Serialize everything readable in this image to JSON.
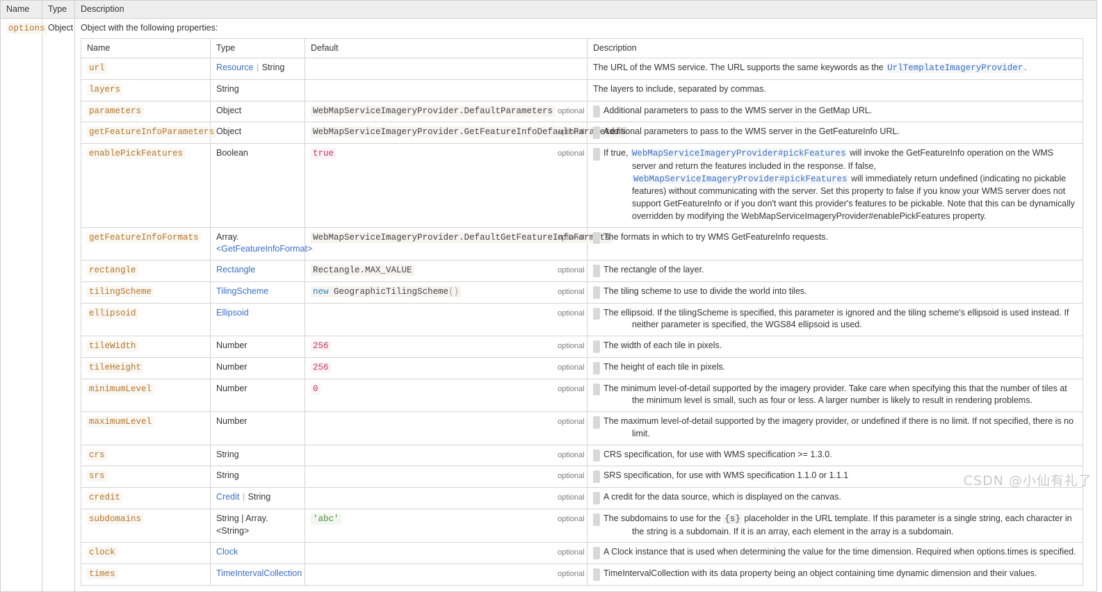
{
  "outer_table": {
    "headers": [
      "Name",
      "Type",
      "Description"
    ],
    "row": {
      "name": "options",
      "type": "Object",
      "intro": "Object with the following properties:"
    }
  },
  "inner_table": {
    "headers": [
      "Name",
      "Type",
      "Default",
      "Description"
    ],
    "badge_optional": "optional",
    "rows": [
      {
        "name": "url",
        "type_link": "Resource",
        "type_sep": "|",
        "type_plain": "String",
        "default": "",
        "optional": false,
        "desc_pre": "The URL of the WMS service. The URL supports the same keywords as the ",
        "desc_link": "UrlTemplateImageryProvider",
        "desc_post": "."
      },
      {
        "name": "layers",
        "type_plain": "String",
        "default": "",
        "optional": false,
        "desc_pre": "The layers to include, separated by commas.",
        "desc_link": "",
        "desc_post": ""
      },
      {
        "name": "parameters",
        "type_plain": "Object",
        "default": "WebMapServiceImageryProvider.DefaultParameters",
        "optional": true,
        "desc_pre": "Additional parameters to pass to the WMS server in the GetMap URL.",
        "desc_link": "",
        "desc_post": ""
      },
      {
        "name": "getFeatureInfoParameters",
        "type_plain": "Object",
        "default": "WebMapServiceImageryProvider.GetFeatureInfoDefaultParameters",
        "optional": true,
        "desc_pre": "Additional parameters to pass to the WMS server in the GetFeatureInfo URL.",
        "desc_link": "",
        "desc_post": ""
      },
      {
        "name": "enablePickFeatures",
        "type_plain": "Boolean",
        "default_literal": "true",
        "optional": true,
        "desc_pre": "If true, ",
        "desc_link": "WebMapServiceImageryProvider#pickFeatures",
        "desc_mid": " will invoke the GetFeatureInfo operation on the WMS server and return the features included in the response. If false, ",
        "desc_link2": "WebMapServiceImageryProvider#pickFeatures",
        "desc_post": " will immediately return undefined (indicating no pickable features) without communicating with the server. Set this property to false if you know your WMS server does not support GetFeatureInfo or if you don't want this provider's features to be pickable. Note that this can be dynamically overridden by modifying the WebMapServiceImageryProvider#enablePickFeatures property."
      },
      {
        "name": "getFeatureInfoFormats",
        "type_plain": "Array.",
        "type_link2": "<GetFeatureInfoFormat>",
        "default": "WebMapServiceImageryProvider.DefaultGetFeatureInfoFormats",
        "optional": true,
        "desc_pre": "The formats in which to try WMS GetFeatureInfo requests.",
        "desc_link": "",
        "desc_post": ""
      },
      {
        "name": "rectangle",
        "type_link": "Rectangle",
        "default": "Rectangle.MAX_VALUE",
        "optional": true,
        "desc_pre": "The rectangle of the layer.",
        "desc_link": "",
        "desc_post": ""
      },
      {
        "name": "tilingScheme",
        "type_link": "TilingScheme",
        "default_new": "new",
        "default_expr": "GeographicTilingScheme",
        "default_parens": "()",
        "optional": true,
        "desc_pre": "The tiling scheme to use to divide the world into tiles.",
        "desc_link": "",
        "desc_post": ""
      },
      {
        "name": "ellipsoid",
        "type_link": "Ellipsoid",
        "default": "",
        "optional": true,
        "desc_pre": "The ellipsoid. If the tilingScheme is specified, this parameter is ignored and the tiling scheme's ellipsoid is used instead. If neither parameter is specified, the WGS84 ellipsoid is used.",
        "desc_link": "",
        "desc_post": ""
      },
      {
        "name": "tileWidth",
        "type_plain": "Number",
        "default_literal": "256",
        "optional": true,
        "desc_pre": "The width of each tile in pixels.",
        "desc_link": "",
        "desc_post": ""
      },
      {
        "name": "tileHeight",
        "type_plain": "Number",
        "default_literal": "256",
        "optional": true,
        "desc_pre": "The height of each tile in pixels.",
        "desc_link": "",
        "desc_post": ""
      },
      {
        "name": "minimumLevel",
        "type_plain": "Number",
        "default_literal": "0",
        "optional": true,
        "desc_pre": "The minimum level-of-detail supported by the imagery provider. Take care when specifying this that the number of tiles at the minimum level is small, such as four or less. A larger number is likely to result in rendering problems.",
        "desc_link": "",
        "desc_post": ""
      },
      {
        "name": "maximumLevel",
        "type_plain": "Number",
        "default": "",
        "optional": true,
        "desc_pre": "The maximum level-of-detail supported by the imagery provider, or undefined if there is no limit. If not specified, there is no limit.",
        "desc_link": "",
        "desc_post": ""
      },
      {
        "name": "crs",
        "type_plain": "String",
        "default": "",
        "optional": true,
        "desc_pre": "CRS specification, for use with WMS specification >= 1.3.0.",
        "desc_link": "",
        "desc_post": ""
      },
      {
        "name": "srs",
        "type_plain": "String",
        "default": "",
        "optional": true,
        "desc_pre": "SRS specification, for use with WMS specification 1.1.0 or 1.1.1",
        "desc_link": "",
        "desc_post": ""
      },
      {
        "name": "credit",
        "type_link": "Credit",
        "type_sep": "|",
        "type_plain": "String",
        "default": "",
        "optional": true,
        "desc_pre": "A credit for the data source, which is displayed on the canvas.",
        "desc_link": "",
        "desc_post": ""
      },
      {
        "name": "subdomains",
        "type_plain": "String | Array.<String>",
        "default_str": "'abc'",
        "optional": true,
        "desc_pre": "The subdomains to use for the ",
        "desc_code": "{s}",
        "desc_post": " placeholder in the URL template. If this parameter is a single string, each character in the string is a subdomain. If it is an array, each element in the array is a subdomain."
      },
      {
        "name": "clock",
        "type_link": "Clock",
        "default": "",
        "optional": true,
        "desc_pre": "A Clock instance that is used when determining the value for the time dimension. Required when options.times is specified.",
        "desc_link": "",
        "desc_post": ""
      },
      {
        "name": "times",
        "type_link": "TimeIntervalCollection",
        "default": "",
        "optional": true,
        "desc_pre": "TimeIntervalCollection with its data property being an object containing time dynamic dimension and their values.",
        "desc_link": "",
        "desc_post": ""
      }
    ]
  },
  "watermark": {
    "text": "CSDN @小仙有礼了"
  },
  "colors": {
    "param_name": "#b5752a",
    "link": "#3a6fc4",
    "number_literal": "#c0395c",
    "string_literal": "#4a8c3f",
    "header_bg": "#eeeeee",
    "badge_bg": "#d8d8d8"
  }
}
